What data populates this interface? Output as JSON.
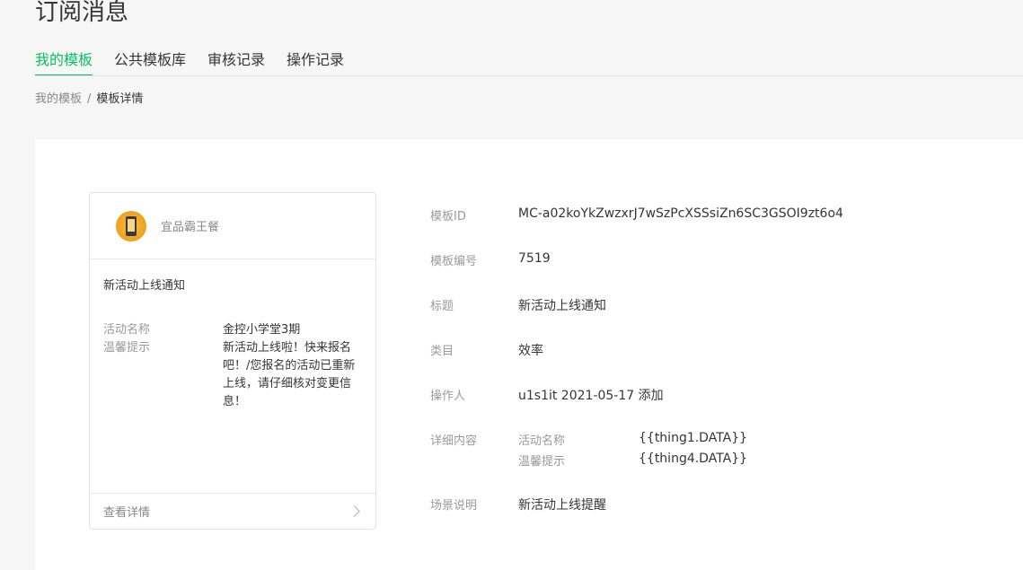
{
  "page": {
    "title": "订阅消息"
  },
  "tabs": [
    {
      "label": "我的模板",
      "active": true
    },
    {
      "label": "公共模板库",
      "active": false
    },
    {
      "label": "审核记录",
      "active": false
    },
    {
      "label": "操作记录",
      "active": false
    }
  ],
  "breadcrumb": {
    "parent": "我的模板",
    "separator": "/",
    "current": "模板详情"
  },
  "preview": {
    "brand_name": "宜品霸王餐",
    "title": "新活动上线通知",
    "fields": [
      {
        "key": "活动名称",
        "value": "金控小学堂3期"
      },
      {
        "key": "温馨提示",
        "value": "新活动上线啦！快来报名吧！/您报名的活动已重新上线，请仔细核对变更信息！"
      }
    ],
    "footer_link": "查看详情"
  },
  "details": {
    "template_id_label": "模板ID",
    "template_id": "MC-a02koYkZwzxrJ7wSzPcXSSsiZn6SC3GSOI9zt6o4",
    "template_no_label": "模板编号",
    "template_no": "7519",
    "title_label": "标题",
    "title": "新活动上线通知",
    "category_label": "类目",
    "category": "效率",
    "operator_label": "操作人",
    "operator": "u1s1it 2021-05-17 添加",
    "content_label": "详细内容",
    "content": [
      {
        "key": "活动名称",
        "value": "{{thing1.DATA}}"
      },
      {
        "key": "温馨提示",
        "value": "{{thing4.DATA}}"
      }
    ],
    "scene_label": "场景说明",
    "scene": "新活动上线提醒"
  },
  "colors": {
    "accent": "#07c160",
    "text": "#353535",
    "muted": "#9a9a9a",
    "bg": "#f6f6f6"
  }
}
